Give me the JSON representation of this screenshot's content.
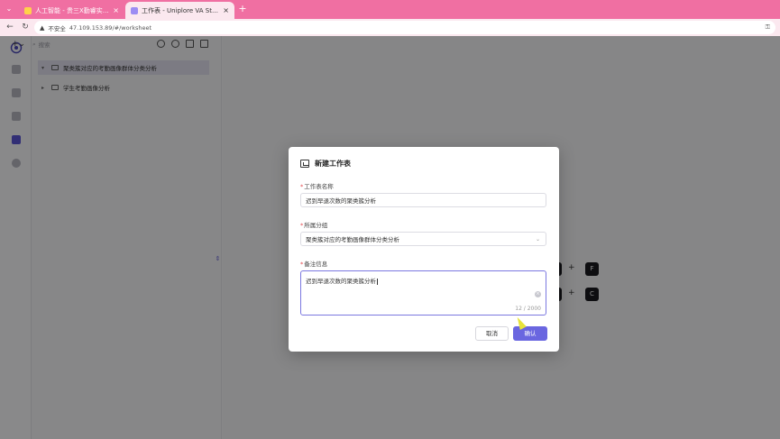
{
  "browser": {
    "tabs": [
      {
        "title": "人工智能 - 贵三X勤睿实践教学平台",
        "active": false
      },
      {
        "title": "工作表 - Uniplore VA Studio",
        "active": true
      }
    ],
    "close_glyph": "×",
    "new_tab_glyph": "+",
    "nav": {
      "back": "←",
      "reload": "↻"
    },
    "security": "不安全",
    "url": "47.109.153.89/#/worksheet"
  },
  "toolbar": {
    "add_glyph": "+⌄",
    "search_placeholder": "搜索"
  },
  "tree": {
    "items": [
      {
        "label": "聚类簇对应的考勤画像群体分类分析",
        "selected": true,
        "expanded": true
      },
      {
        "label": "学生考勤画像分析",
        "selected": false,
        "expanded": false
      }
    ]
  },
  "shortcuts": [
    {
      "key": "F",
      "plus": "+"
    },
    {
      "key": "C",
      "plus": "+"
    }
  ],
  "modal": {
    "title": "新建工作表",
    "name_label": "工作表名称",
    "name_value": "迟到早退次数的聚类簇分析",
    "group_label": "所属分组",
    "group_value": "聚类簇对应的考勤画像群体分类分析",
    "notes_label": "备注信息",
    "notes_value": "迟到早退次数的聚类簇分析",
    "notes_count": "12 / 2000",
    "cancel_label": "取消",
    "ok_label": "确认",
    "required_mark": "*"
  },
  "colors": {
    "tabbar": "#f06fa2",
    "accent": "#6a66e0"
  }
}
